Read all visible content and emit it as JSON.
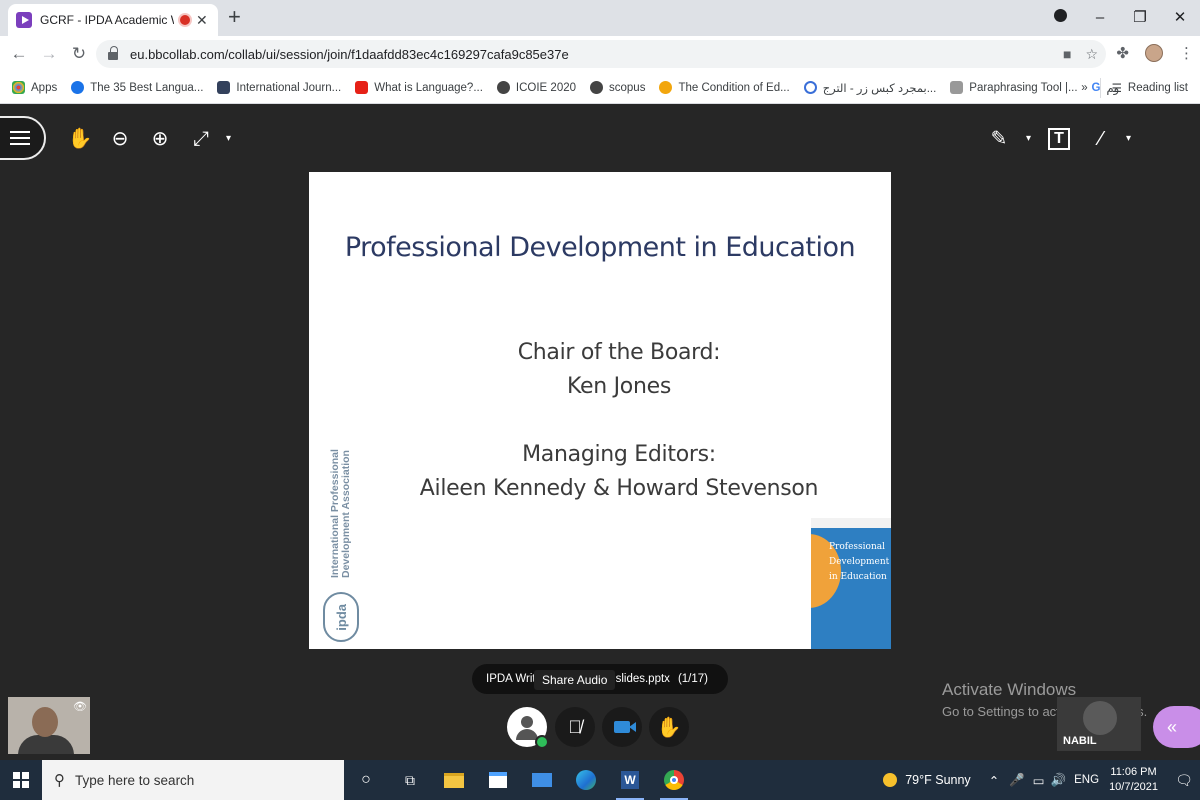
{
  "browser": {
    "tab_title": "GCRF - IPDA Academic Writ",
    "tab_close": "✕",
    "new_tab": "+",
    "url": "eu.bbcollab.com/collab/ui/session/join/f1daafdd83ec4c169297cafa9c85e37e",
    "bookmarks": [
      {
        "label": "Apps",
        "color": "#4285f4"
      },
      {
        "label": "The 35 Best Langua...",
        "color": "#1a73e8"
      },
      {
        "label": "International Journ...",
        "color": "#33415c"
      },
      {
        "label": "What is Language?...",
        "color": "#e62117"
      },
      {
        "label": "ICOIE 2020",
        "color": "#444444"
      },
      {
        "label": "scopus",
        "color": "#444444"
      },
      {
        "label": "The Condition of Ed...",
        "color": "#f2a60d"
      },
      {
        "label": "بمجرد كبس زر - الترج...",
        "color": "#3a6fd8"
      },
      {
        "label": "Paraphrasing Tool |...",
        "color": "#666666"
      },
      {
        "label": "وم",
        "color": "#4285f4"
      }
    ],
    "bookmarks_more": "»",
    "reading_list": "Reading list"
  },
  "slide": {
    "title": "Professional Development in Education",
    "chair_label": "Chair of the Board:",
    "chair_name": "Ken Jones",
    "editors_label": "Managing Editors:",
    "editors_names": "Aileen Kennedy & Howard Stevenson",
    "org_line1": "International Professional",
    "org_line2": "Development Association",
    "logo_text": "ipda",
    "cover_title_1": "Professional",
    "cover_title_2": "Development",
    "cover_title_3": "in Education"
  },
  "session": {
    "share_name": "IPDA Writ",
    "share_file": "n slides.pptx",
    "share_pages": "(1/17)",
    "tooltip": "Share Audio",
    "activate_title": "Activate Windows",
    "activate_sub": "Go to Settings to activate Windows.",
    "participant_name": "NABIL"
  },
  "taskbar": {
    "search_placeholder": "Type here to search",
    "weather": "79°F  Sunny",
    "language": "ENG",
    "time": "11:06 PM",
    "date": "10/7/2021"
  }
}
